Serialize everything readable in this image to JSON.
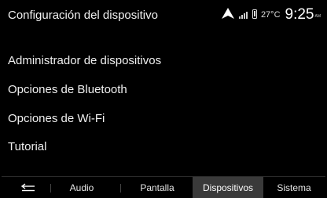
{
  "header": {
    "title": "Configuración del dispositivo",
    "temperature": "27°C",
    "time": "9:25",
    "ampm": "AM",
    "icons": [
      "navigation-arrow-icon",
      "signal-bars-icon",
      "phone-icon"
    ]
  },
  "menu": {
    "items": [
      {
        "label": "Administrador de dispositivos"
      },
      {
        "label": "Opciones de Bluetooth"
      },
      {
        "label": "Opciones de Wi-Fi"
      },
      {
        "label": "Tutorial"
      }
    ]
  },
  "tabs": {
    "back_icon": "back-arrow-icon",
    "items": [
      {
        "label": "Audio"
      },
      {
        "label": "Pantalla"
      },
      {
        "label": "Dispositivos"
      },
      {
        "label": "Sistema"
      }
    ],
    "active": "Dispositivos"
  },
  "colors": {
    "background": "#000000",
    "active_tab": "#3a3a3a",
    "text": "#f0f0f0"
  }
}
